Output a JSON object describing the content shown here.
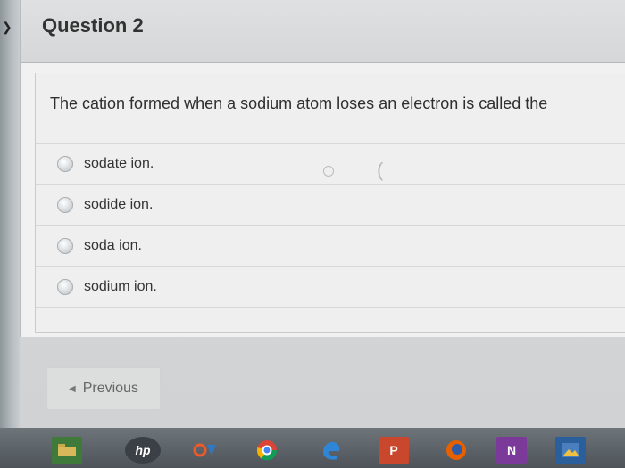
{
  "question": {
    "title": "Question 2",
    "text": "The cation formed when a sodium atom loses an electron is called the",
    "options": [
      {
        "label": "sodate ion.",
        "selected": false
      },
      {
        "label": "sodide ion.",
        "selected": false
      },
      {
        "label": "soda ion.",
        "selected": false
      },
      {
        "label": "sodium ion.",
        "selected": false
      }
    ]
  },
  "navigation": {
    "previous_label": "Previous"
  },
  "taskbar": {
    "icons": [
      "folder-icon",
      "hp-icon",
      "office-icon",
      "chrome-icon",
      "edge-icon",
      "powerpoint-icon",
      "firefox-icon",
      "onenote-icon",
      "photos-icon"
    ],
    "hp_text": "hp",
    "powerpoint_text": "P",
    "onenote_text": "N"
  }
}
